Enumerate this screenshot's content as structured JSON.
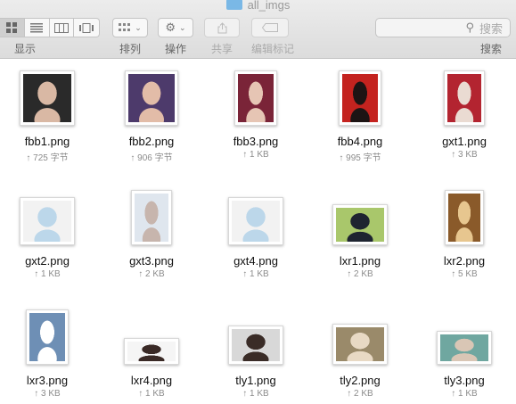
{
  "window": {
    "title": "all_imgs"
  },
  "toolbar": {
    "display_label": "显示",
    "arrange_label": "排列",
    "action_label": "操作",
    "share_label": "共享",
    "edit_tags_label": "编辑标记",
    "search_label": "搜索",
    "search_placeholder": "搜索"
  },
  "files": [
    {
      "name": "fbb1.png",
      "size": "↑ 725 字节",
      "colors": [
        "#2a2a2a",
        "#d9b8a4"
      ]
    },
    {
      "name": "fbb2.png",
      "size": "↑ 906 字节",
      "colors": [
        "#4d3a6b",
        "#e2bca8"
      ]
    },
    {
      "name": "fbb3.png",
      "size": "↑ 1 KB",
      "colors": [
        "#7a2438",
        "#e6c5b4"
      ]
    },
    {
      "name": "fbb4.png",
      "size": "↑ 995 字节",
      "colors": [
        "#c4231f",
        "#1d1414"
      ]
    },
    {
      "name": "gxt1.png",
      "size": "↑ 3 KB",
      "colors": [
        "#b32430",
        "#eadbd2"
      ]
    },
    {
      "name": "gxt2.png",
      "size": "↑ 1 KB",
      "colors": [
        "#f2f2f2",
        "#bcd7ea"
      ]
    },
    {
      "name": "gxt3.png",
      "size": "↑ 2 KB",
      "colors": [
        "#dfe6ee",
        "#c7b5ad"
      ]
    },
    {
      "name": "gxt4.png",
      "size": "↑ 1 KB",
      "colors": [
        "#f2f2f2",
        "#bcd7ea"
      ]
    },
    {
      "name": "lxr1.png",
      "size": "↑ 2 KB",
      "colors": [
        "#a9c76b",
        "#1e2430"
      ]
    },
    {
      "name": "lxr2.png",
      "size": "↑ 5 KB",
      "colors": [
        "#8a5a2a",
        "#e7c68f"
      ]
    },
    {
      "name": "lxr3.png",
      "size": "↑ 3 KB",
      "colors": [
        "#6e8fb5",
        "#ffffff"
      ]
    },
    {
      "name": "lxr4.png",
      "size": "↑ 1 KB",
      "colors": [
        "#f5f5f5",
        "#3a2a26"
      ]
    },
    {
      "name": "tly1.png",
      "size": "↑ 1 KB",
      "colors": [
        "#d8d8d8",
        "#3a2c27"
      ]
    },
    {
      "name": "tly2.png",
      "size": "↑ 2 KB",
      "colors": [
        "#9a8a6a",
        "#e8d9c4"
      ]
    },
    {
      "name": "tly3.png",
      "size": "↑ 1 KB",
      "colors": [
        "#6fa7a0",
        "#d9c6b5"
      ]
    }
  ]
}
